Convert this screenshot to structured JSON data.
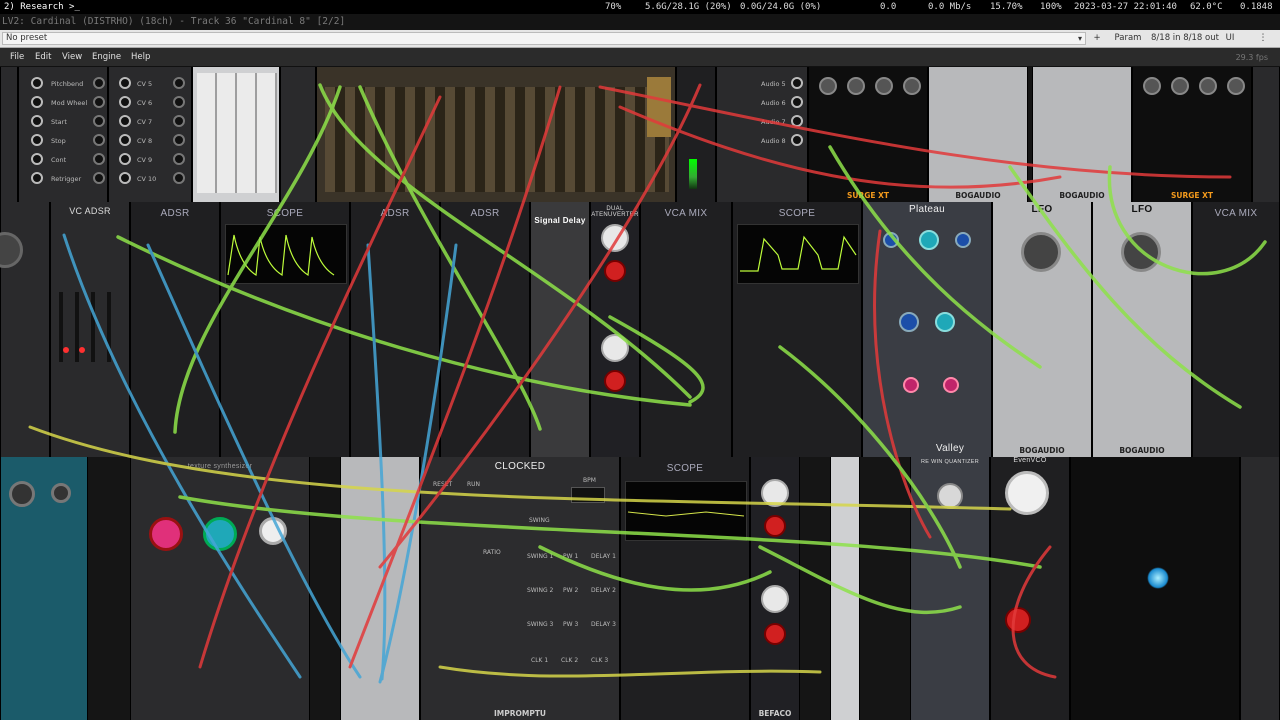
{
  "status_bar": {
    "workspace": "2) Research >_",
    "volume": "70%",
    "memory": "5.6G/28.1G (20%)",
    "swap": "0.0G/24.0G (0%)",
    "net_traffic": "0.0",
    "net_rate": "0.0 Mb/s",
    "cpu": "15.70%",
    "battery": "100%",
    "datetime": "2023-03-27 22:01:40",
    "temp": "62.0°C",
    "load": "0.1848"
  },
  "window": {
    "title": "LV2: Cardinal (DISTRHO) (18ch) - Track 36 \"Cardinal 8\" [2/2]"
  },
  "host_bar": {
    "preset": "No preset",
    "add_label": "+",
    "param_label": "Param",
    "io_label": "8/18 in 8/18 out",
    "ui_label": "UI"
  },
  "menu": {
    "items": [
      "File",
      "Edit",
      "View",
      "Engine",
      "Help"
    ],
    "fps": "29.3 fps"
  },
  "modules": {
    "vc_adsr": "VC ADSR",
    "adsr1": "ADSR",
    "scope1": "SCOPE",
    "adsr2": "ADSR",
    "adsr3": "ADSR",
    "signal_delay": "Signal Delay",
    "dual_atten": "DUAL\nATENUVERTER",
    "vca_mix1": "VCA MIX",
    "scope2": "SCOPE",
    "plateau": "Plateau",
    "lfo1": "LFO",
    "lfo2": "LFO",
    "vca_mix2": "VCA MIX",
    "clocked": "CLOCKED",
    "scope3": "SCOPE",
    "valley": "Valley",
    "texture": "texture synthesizer",
    "impromptu": "IMPROMPTU",
    "surge1": "SURGE XT",
    "surge2": "SURGE XT",
    "bogaudio": "BOGAUDIO",
    "befaco": "BEFACO",
    "even_vco": "EvenVCO",
    "quantizer": "RE WIN QUANTIZER"
  },
  "midi_outputs": [
    "Pitchbend",
    "Mod Wheel",
    "Start",
    "Stop",
    "Cont",
    "Retrigger"
  ],
  "cv_outputs": [
    "CV 5",
    "CV 6",
    "CV 7",
    "CV 8",
    "CV 9",
    "CV 10"
  ],
  "audio_outputs": [
    "Audio 5",
    "Audio 6",
    "Audio 7",
    "Audio 8"
  ],
  "clock_labels": [
    "RESET",
    "RUN",
    "BPM",
    "SWING",
    "RATIO",
    "SWING 1",
    "PW 1",
    "DELAY 1",
    "SWING 2",
    "PW 2",
    "DELAY 2",
    "SWING 3",
    "PW 3",
    "DELAY 3",
    "CLK 1",
    "CLK 2",
    "CLK 3"
  ],
  "colors": {
    "cable_green": "#8ee24a",
    "cable_red": "#e23a3a",
    "cable_blue": "#45a6d6",
    "cable_yellow": "#d6d64a",
    "accent_pink": "#e0307a",
    "accent_cyan": "#1fa8b8"
  }
}
